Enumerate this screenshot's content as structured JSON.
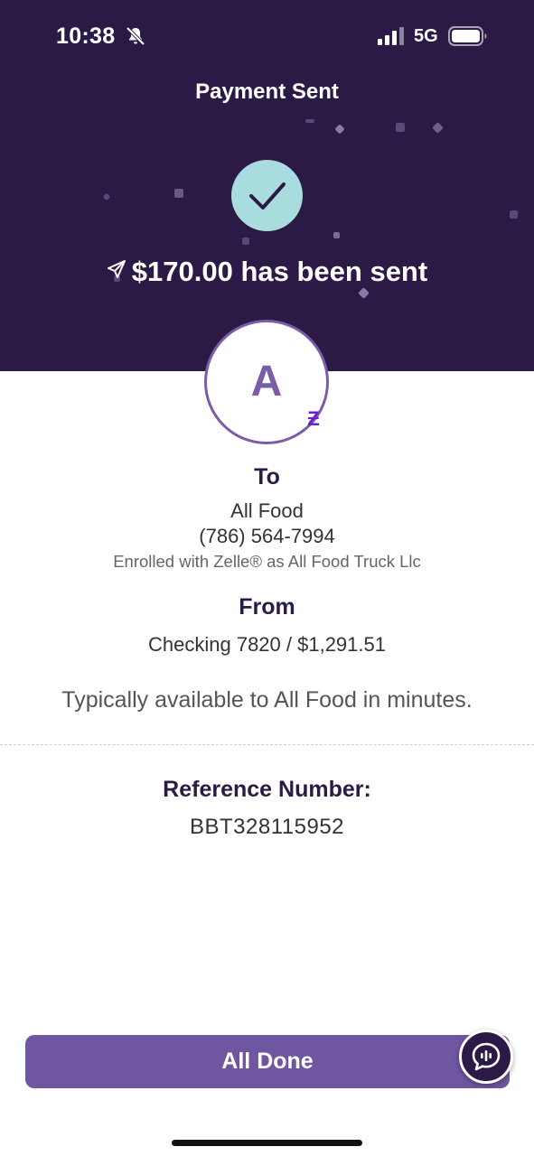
{
  "status_bar": {
    "time": "10:38",
    "network": "5G",
    "icons": [
      "bell-slash-icon",
      "signal-icon",
      "battery-icon"
    ]
  },
  "header": {
    "title": "Payment Sent",
    "background_color": "#2b1a45"
  },
  "confirmation": {
    "icon": "checkmark-icon",
    "accent_color": "#a9dcdf",
    "sent_message": "$170.00 has been sent",
    "sent_icon": "send-icon"
  },
  "recipient": {
    "avatar_letter": "A",
    "avatar_badge_icon": "zelle-icon",
    "to_label": "To",
    "name": "All Food",
    "phone": "(786) 564-7994",
    "enrolled": "Enrolled with Zelle® as All Food Truck Llc"
  },
  "source": {
    "from_label": "From",
    "account": "Checking 7820 / $1,291.51"
  },
  "availability": "Typically available to All Food in minutes.",
  "reference": {
    "label": "Reference Number:",
    "value": "BBT328115952"
  },
  "actions": {
    "done_label": "All Done",
    "chat_icon": "chat-voice-icon",
    "button_color": "#6f56a0"
  }
}
